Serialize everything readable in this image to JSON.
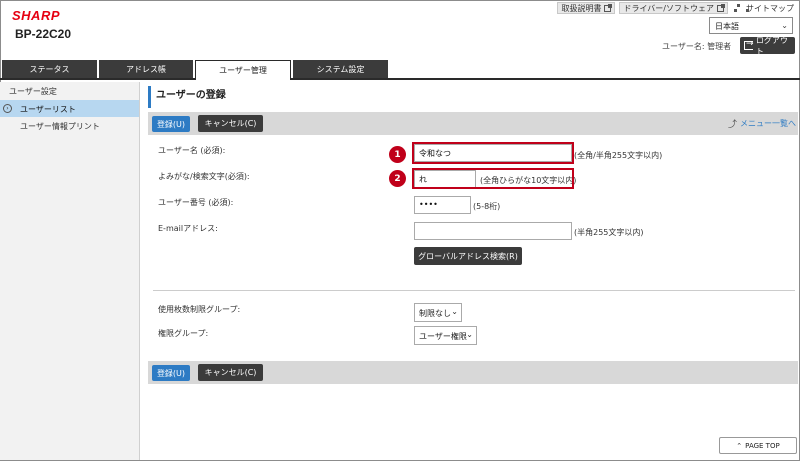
{
  "header": {
    "brand": "SHARP",
    "model": "BP-22C20",
    "links": [
      {
        "label": "取扱説明書",
        "icon": "external-icon"
      },
      {
        "label": "ドライバー/ソフトウェア",
        "icon": "external-icon"
      }
    ],
    "sitemap_label": "サイトマップ",
    "language": "日本語",
    "user_label": "ユーザー名: 管理者",
    "logout_label": "ログアウト"
  },
  "tabs": [
    {
      "label": "ステータス",
      "active": false
    },
    {
      "label": "アドレス帳",
      "active": false
    },
    {
      "label": "ユーザー管理",
      "active": true
    },
    {
      "label": "システム設定",
      "active": false
    }
  ],
  "sidebar": {
    "heading": "ユーザー設定",
    "items": [
      {
        "label": "ユーザーリスト",
        "active": true
      },
      {
        "label": "ユーザー情報プリント",
        "active": false
      }
    ]
  },
  "main": {
    "title": "ユーザーの登録",
    "register_label": "登録(U)",
    "cancel_label": "キャンセル(C)",
    "back_to_menu": "メニュー一覧へ",
    "fields": {
      "username": {
        "label": "ユーザー名 (必須):",
        "value": "令和なつ",
        "note": "(全角/半角255文字以内)"
      },
      "yomigana": {
        "label": "よみがな/検索文字(必須):",
        "value": "れ",
        "note": "(全角ひらがな10文字以内)"
      },
      "usernumber": {
        "label": "ユーザー番号 (必須):",
        "value": "••••",
        "note": "(5-8桁)"
      },
      "email": {
        "label": "E-mailアドレス:",
        "value": "",
        "note": "(半角255文字以内)"
      }
    },
    "global_search_label": "グローバルアドレス検索(R)",
    "quota_group": {
      "label": "使用枚数制限グループ:",
      "value": "制限なし"
    },
    "auth_group": {
      "label": "権限グループ:",
      "value": "ユーザー権限"
    },
    "callouts": [
      "1",
      "2"
    ]
  },
  "footer": {
    "page_top": "PAGE TOP"
  },
  "colors": {
    "accent": "#2d7bc4",
    "highlight": "#c0001a",
    "brand": "#e60012"
  }
}
